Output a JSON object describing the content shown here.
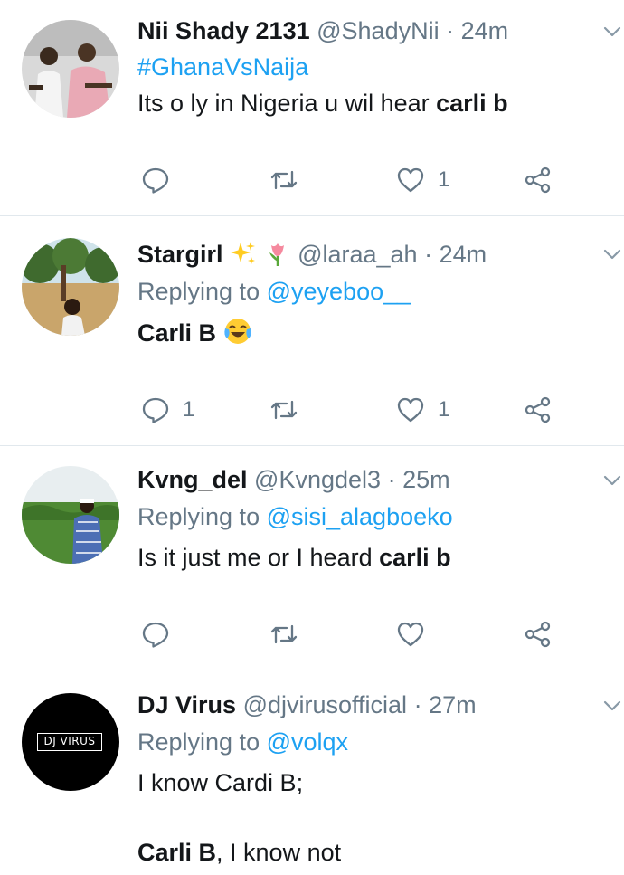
{
  "tweets": [
    {
      "name": "Nii Shady 2131",
      "handle": "@ShadyNii",
      "dot": "·",
      "time": "24m",
      "hashtag": "#GhanaVsNaija",
      "text_plain": "Its o ly in Nigeria u wil hear ",
      "text_bold": "carli b",
      "replies": "",
      "likes": "1"
    },
    {
      "name": "Stargirl",
      "name_emojis": [
        "sparkles",
        "tulip"
      ],
      "handle": "@laraa_ah",
      "dot": "·",
      "time": "24m",
      "replying_label": "Replying to",
      "replying_to": "@yeyeboo__",
      "text_bold": "Carli B",
      "text_emoji": "face-with-tears-of-joy",
      "replies": "1",
      "likes": "1"
    },
    {
      "name": "Kvng_del",
      "handle": "@Kvngdel3",
      "dot": "·",
      "time": "25m",
      "replying_label": "Replying to",
      "replying_to": "@sisi_alagboeko",
      "text_plain": "Is it just me or I heard ",
      "text_bold": "carli b",
      "replies": "",
      "likes": ""
    },
    {
      "name": "DJ Virus",
      "handle": "@djvirusofficial",
      "dot": "·",
      "time": "27m",
      "replying_label": "Replying to",
      "replying_to": "@volqx",
      "text_line1": "I know Cardi B;",
      "text_line2_bold": "Carli B",
      "text_line2_plain": ", I know not",
      "avatar_text": "DJ VIRUS"
    }
  ],
  "icons": [
    "reply-icon",
    "retweet-icon",
    "like-icon",
    "share-icon",
    "caret-down-icon"
  ],
  "colors": {
    "text": "#14171a",
    "secondary": "#657786",
    "link": "#1da1f2",
    "divider": "#e1e8ed"
  }
}
